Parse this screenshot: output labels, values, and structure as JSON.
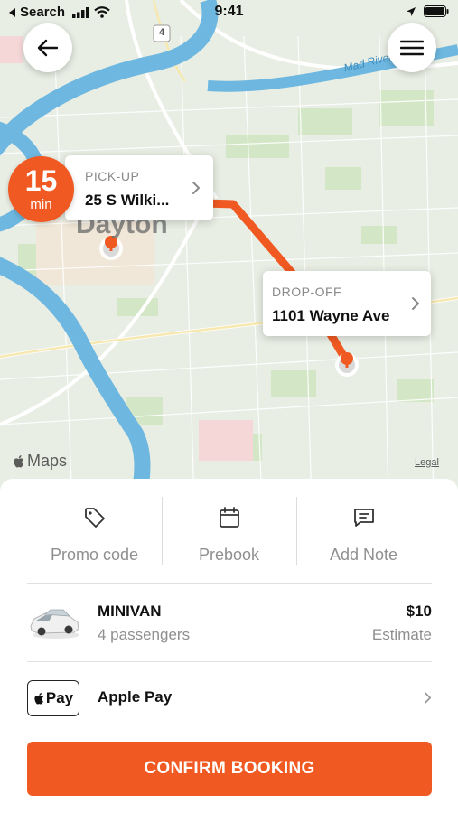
{
  "status_bar": {
    "back_app": "Search",
    "time": "9:41"
  },
  "map": {
    "city_label": "Dayton",
    "river_label": "Mad River",
    "route_shield": "4",
    "maps_brand": "Maps",
    "legal": "Legal",
    "route_color": "#f05a22"
  },
  "eta": {
    "value": "15",
    "unit": "min"
  },
  "pickup": {
    "label": "PICK-UP",
    "address": "25 S Wilki..."
  },
  "dropoff": {
    "label": "DROP-OFF",
    "address": "1101 Wayne Ave"
  },
  "options": [
    {
      "label": "Promo code",
      "icon": "tag-icon"
    },
    {
      "label": "Prebook",
      "icon": "calendar-icon"
    },
    {
      "label": "Add Note",
      "icon": "note-icon"
    }
  ],
  "ride": {
    "name": "MINIVAN",
    "passengers": "4 passengers",
    "price": "$10",
    "price_note": "Estimate"
  },
  "payment": {
    "badge": "Pay",
    "name": "Apple Pay"
  },
  "confirm_label": "CONFIRM BOOKING",
  "colors": {
    "accent": "#f05a22",
    "water": "#5fb2de",
    "park": "#cde6c0"
  }
}
